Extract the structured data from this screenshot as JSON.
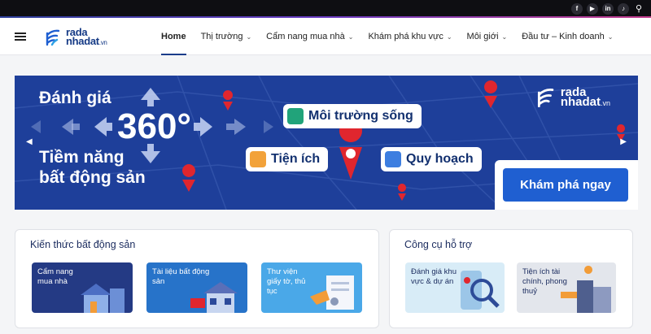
{
  "topbar": {
    "social": [
      {
        "icon": "facebook-icon",
        "glyph": "f"
      },
      {
        "icon": "youtube-icon",
        "glyph": "▶"
      },
      {
        "icon": "linkedin-icon",
        "glyph": "in"
      },
      {
        "icon": "tiktok-icon",
        "glyph": "♪"
      }
    ],
    "search_icon": "search-icon"
  },
  "nav": {
    "logo_line1": "rada",
    "logo_line2": "nhadat",
    "logo_suffix": ".vn",
    "items": [
      {
        "label": "Home",
        "active": true,
        "dropdown": false
      },
      {
        "label": "Thị trường",
        "dropdown": true
      },
      {
        "label": "Cẩm nang mua nhà",
        "dropdown": true
      },
      {
        "label": "Khám phá khu vực",
        "dropdown": true
      },
      {
        "label": "Môi giới",
        "dropdown": true
      },
      {
        "label": "Đầu tư – Kinh doanh",
        "dropdown": true
      }
    ]
  },
  "banner": {
    "title_line1": "Đánh giá",
    "big": "360°",
    "title_line2": "Tiềm năng",
    "title_line3": "bất động sản",
    "chips": [
      "Môi trường sống",
      "Tiện ích",
      "Quy hoạch"
    ],
    "logo_line1": "rada",
    "logo_line2": "nhadat",
    "logo_suffix": ".vn",
    "cta": "Khám phá ngay",
    "colors": {
      "bg": "#1e3f9a",
      "cta": "#1f5fd1",
      "pin": "#e0262e"
    }
  },
  "knowledge": {
    "title": "Kiến thức bất động sản",
    "tiles": [
      {
        "label": "Cẩm nang mua nhà",
        "color": "#243a84"
      },
      {
        "label": "Tài liệu bất động sản",
        "color": "#2773c9"
      },
      {
        "label": "Thư viện giấy tờ, thủ tục",
        "color": "#4aa8e8"
      }
    ]
  },
  "tools": {
    "title": "Công cụ hỗ trợ",
    "tiles": [
      {
        "label": "Đánh giá khu vực & dự án",
        "color": "#d8ecf7"
      },
      {
        "label": "Tiện ích tài chính, phong thuỷ",
        "color": "#e3e6ec"
      }
    ]
  }
}
